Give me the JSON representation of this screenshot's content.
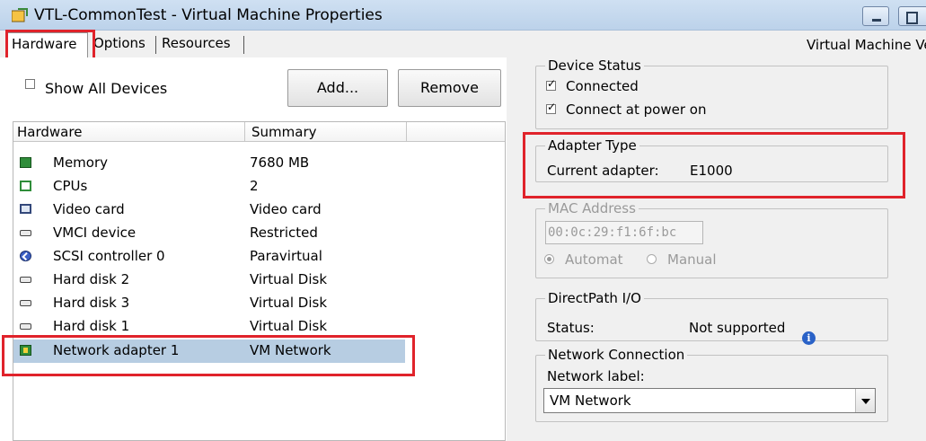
{
  "window": {
    "title": "VTL-CommonTest - Virtual Machine Properties",
    "version_text": "Virtual Machine Ve"
  },
  "tabs": [
    {
      "label": "Hardware"
    },
    {
      "label": "Options"
    },
    {
      "label": "Resources"
    }
  ],
  "toolbar": {
    "show_all_label": "Show All Devices",
    "show_all_checked": false,
    "add_label": "Add...",
    "remove_label": "Remove"
  },
  "hardware_table": {
    "columns": [
      "Hardware",
      "Summary"
    ],
    "rows": [
      {
        "name": "Memory",
        "summary": "7680 MB",
        "icon": "memory-icon"
      },
      {
        "name": "CPUs",
        "summary": "2",
        "icon": "cpu-icon"
      },
      {
        "name": "Video card",
        "summary": "Video card",
        "icon": "video-card-icon"
      },
      {
        "name": "VMCI device",
        "summary": "Restricted",
        "icon": "vmci-device-icon"
      },
      {
        "name": "SCSI controller 0",
        "summary": "Paravirtual",
        "icon": "scsi-controller-icon"
      },
      {
        "name": "Hard disk 2",
        "summary": "Virtual Disk",
        "icon": "hard-disk-icon"
      },
      {
        "name": "Hard disk 3",
        "summary": "Virtual Disk",
        "icon": "hard-disk-icon"
      },
      {
        "name": "Hard disk 1",
        "summary": "Virtual Disk",
        "icon": "hard-disk-icon"
      },
      {
        "name": "Network adapter 1",
        "summary": "VM Network",
        "icon": "network-adapter-icon",
        "selected": true
      }
    ]
  },
  "device_status": {
    "title": "Device Status",
    "connected_label": "Connected",
    "connected_checked": true,
    "power_on_label": "Connect at power on",
    "power_on_checked": true
  },
  "adapter_type": {
    "title": "Adapter Type",
    "current_label": "Current adapter:",
    "current_value": "E1000"
  },
  "mac_address": {
    "title": "MAC Address",
    "value": "00:0c:29:f1:6f:bc",
    "automatic_label": "Automat",
    "manual_label": "Manual",
    "automatic_selected": true
  },
  "directpath": {
    "title": "DirectPath I/O",
    "status_label": "Status:",
    "status_value": "Not supported"
  },
  "network_connection": {
    "title": "Network Connection",
    "label": "Network label:",
    "selected": "VM Network"
  },
  "colors": {
    "highlight_box": "#e0232b",
    "selection": "#b7cde2"
  }
}
